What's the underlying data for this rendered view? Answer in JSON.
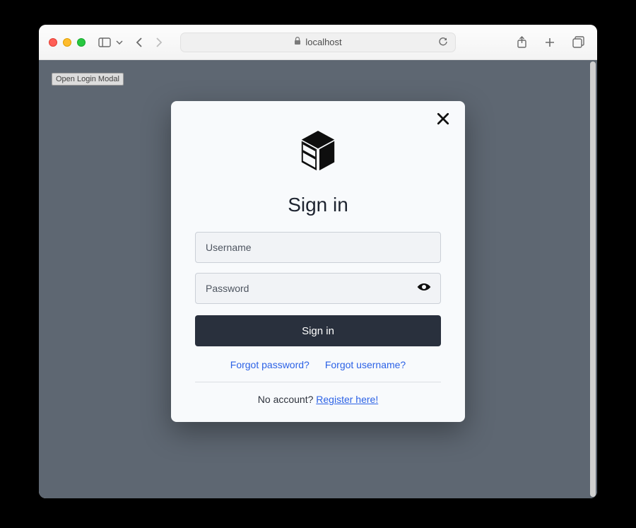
{
  "browser": {
    "url_label": "localhost"
  },
  "page": {
    "open_modal_button": "Open Login Modal"
  },
  "modal": {
    "heading": "Sign in",
    "username_placeholder": "Username",
    "password_placeholder": "Password",
    "submit_label": "Sign in",
    "forgot_password": "Forgot password?",
    "forgot_username": "Forgot username?",
    "no_account_prefix": "No account? ",
    "register_link": "Register here!"
  }
}
